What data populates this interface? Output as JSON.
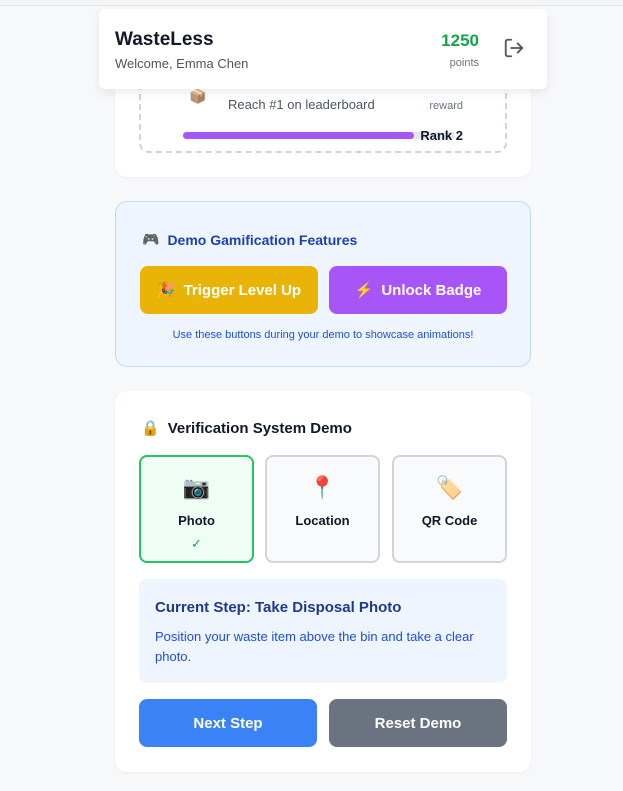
{
  "header": {
    "app_title": "WasteLess",
    "welcome": "Welcome, Emma Chen",
    "points_value": "1250",
    "points_label": "points",
    "logout_icon": "logout-icon"
  },
  "goal_card": {
    "emoji": "📦",
    "goal_text": "Reach #1 on leaderboard",
    "reward_label": "reward",
    "rank_label": "Rank 2",
    "progress_percent": 85,
    "progress_color": "#a855f7"
  },
  "demo": {
    "emoji": "🎮",
    "title": "Demo Gamification Features",
    "level_up_emoji": "🎉",
    "level_up_label": "Trigger Level Up",
    "badge_emoji": "⚡",
    "badge_label": "Unlock Badge",
    "note": "Use these buttons during your demo to showcase animations!"
  },
  "verification": {
    "emoji": "🔒",
    "title": "Verification System Demo",
    "steps": [
      {
        "icon": "📷",
        "label": "Photo",
        "status": "✓"
      },
      {
        "icon": "📍",
        "label": "Location",
        "status": ""
      },
      {
        "icon": "🏷️",
        "label": "QR Code",
        "status": ""
      }
    ],
    "current_step_title": "Current Step: Take Disposal Photo",
    "current_step_desc": "Position your waste item above the bin and take a clear photo.",
    "next_label": "Next Step",
    "reset_label": "Reset Demo"
  },
  "colors": {
    "points": "#16a34a",
    "level_up": "#eab308",
    "badge": "#a855f7",
    "next": "#3b82f6",
    "reset": "#6b7280",
    "active_step": "#22c55e"
  }
}
